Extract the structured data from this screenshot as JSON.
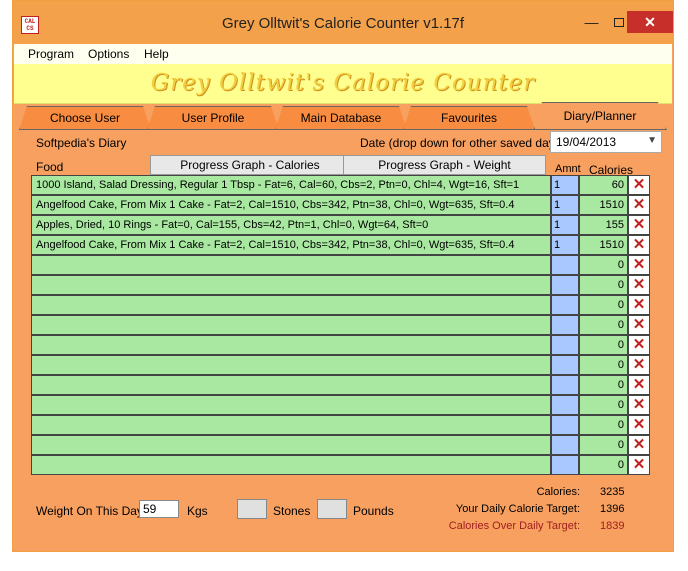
{
  "window": {
    "title": "Grey Olltwit's Calorie Counter v1.17f",
    "app_icon_text": "CAL\nCS",
    "minimize_glyph": "—",
    "close_glyph": "✕"
  },
  "menu": [
    "Program",
    "Options",
    "Help"
  ],
  "banner": "Grey Olltwit's Calorie Counter",
  "tabs": [
    {
      "label": "Choose User",
      "active": false
    },
    {
      "label": "User Profile",
      "active": false
    },
    {
      "label": "Main Database",
      "active": false
    },
    {
      "label": "Favourites",
      "active": false
    },
    {
      "label": "Diary/Planner",
      "active": true
    }
  ],
  "diary": {
    "name": "Softpedia's Diary",
    "date_label": "Date (drop down for other saved days):",
    "date_value": "19/04/2013",
    "food_header": "Food",
    "graph_calories_label": "Progress Graph - Calories",
    "graph_weight_label": "Progress Graph - Weight",
    "amnt_header": "Amnt",
    "calories_header": "Calories",
    "delete_glyph": "✕",
    "rows": [
      {
        "food": "1000 Island, Salad Dressing, Regular 1 Tbsp - Fat=6, Cal=60, Cbs=2, Ptn=0, Chl=4, Wgt=16, Sft=1",
        "amnt": "1",
        "calories": "60"
      },
      {
        "food": "Angelfood Cake, From Mix 1 Cake - Fat=2, Cal=1510, Cbs=342, Ptn=38, Chl=0, Wgt=635, Sft=0.4",
        "amnt": "1",
        "calories": "1510"
      },
      {
        "food": "Apples, Dried, 10 Rings - Fat=0, Cal=155, Cbs=42, Ptn=1, Chl=0, Wgt=64, Sft=0",
        "amnt": "1",
        "calories": "155"
      },
      {
        "food": "Angelfood Cake, From Mix 1 Cake - Fat=2, Cal=1510, Cbs=342, Ptn=38, Chl=0, Wgt=635, Sft=0.4",
        "amnt": "1",
        "calories": "1510"
      },
      {
        "food": "",
        "amnt": "",
        "calories": "0"
      },
      {
        "food": "",
        "amnt": "",
        "calories": "0"
      },
      {
        "food": "",
        "amnt": "",
        "calories": "0"
      },
      {
        "food": "",
        "amnt": "",
        "calories": "0"
      },
      {
        "food": "",
        "amnt": "",
        "calories": "0"
      },
      {
        "food": "",
        "amnt": "",
        "calories": "0"
      },
      {
        "food": "",
        "amnt": "",
        "calories": "0"
      },
      {
        "food": "",
        "amnt": "",
        "calories": "0"
      },
      {
        "food": "",
        "amnt": "",
        "calories": "0"
      },
      {
        "food": "",
        "amnt": "",
        "calories": "0"
      },
      {
        "food": "",
        "amnt": "",
        "calories": "0"
      }
    ]
  },
  "weight": {
    "label": "Weight On This Day:",
    "value": "59",
    "unit_kgs": "Kgs",
    "unit_stones": "Stones",
    "unit_pounds": "Pounds"
  },
  "summary": {
    "calories_label": "Calories:",
    "calories_value": "3235",
    "target_label": "Your Daily Calorie Target:",
    "target_value": "1396",
    "over_label": "Calories Over Daily Target:",
    "over_value": "1839"
  },
  "colors": {
    "food_cell": "#a8e8a0",
    "amnt_cell": "#a8c8ff",
    "tab": "#f88c40",
    "background": "#f7a060",
    "banner": "#ffff90",
    "delete": "#c02020"
  }
}
